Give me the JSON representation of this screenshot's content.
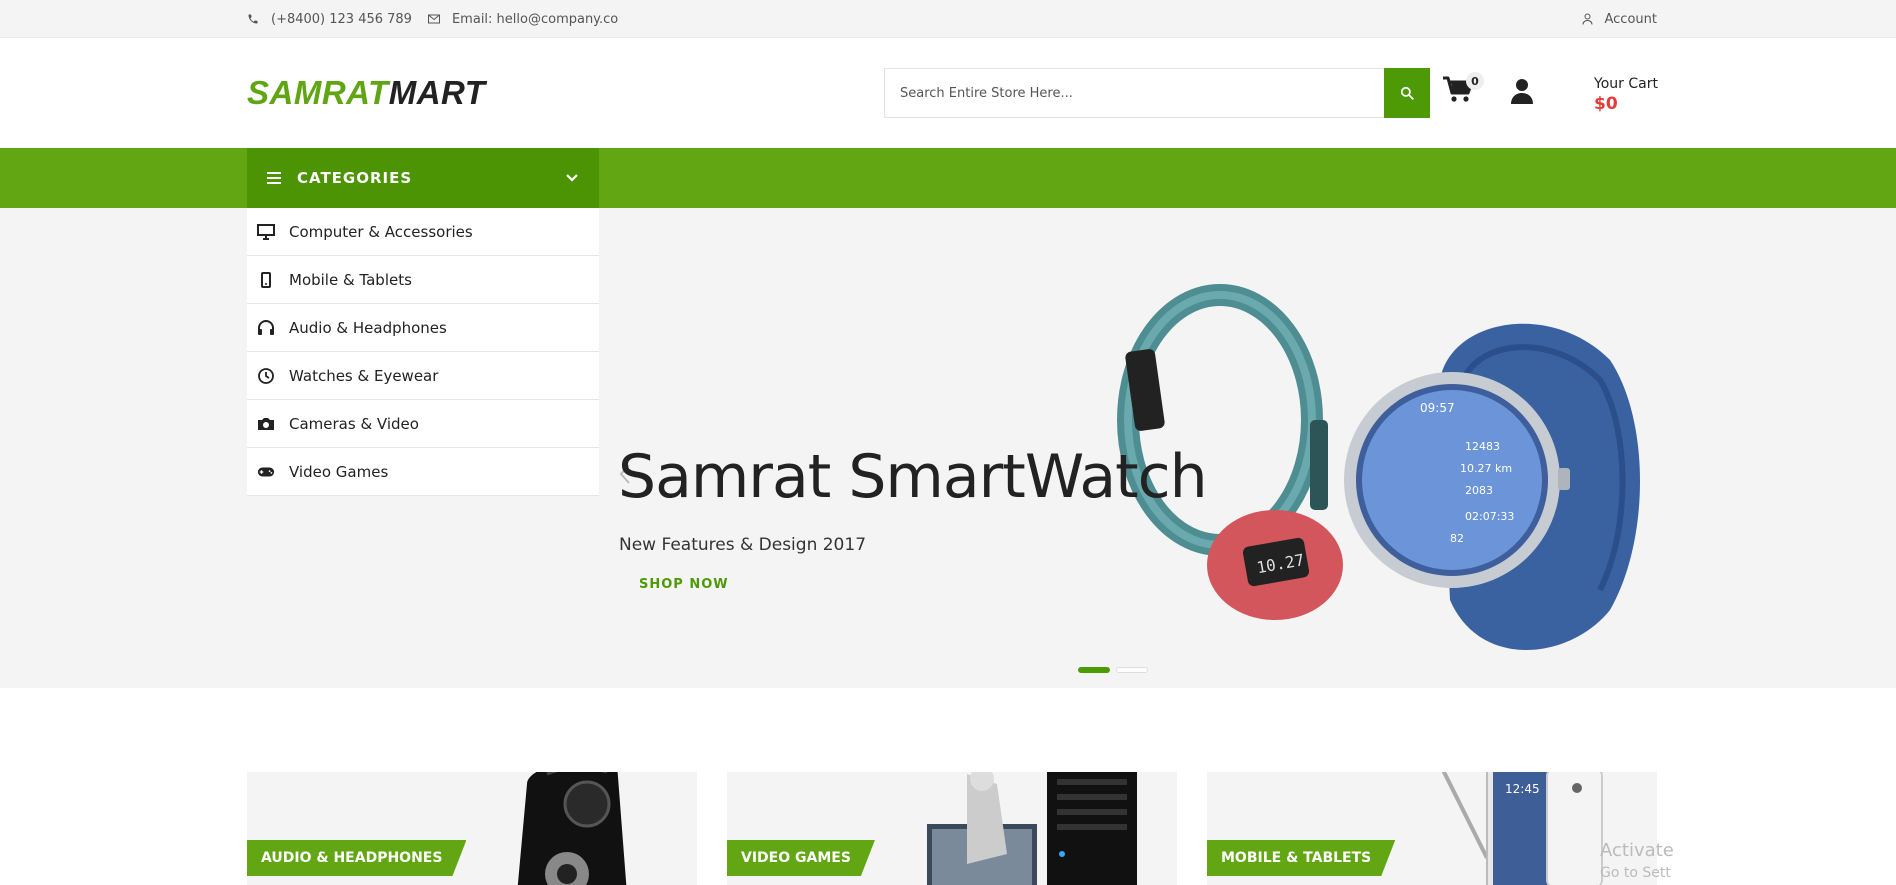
{
  "topbar": {
    "phone": "(+8400) 123 456 789",
    "email": "Email: hello@company.co",
    "account": "Account"
  },
  "header": {
    "logo_part1": "SAMRAT",
    "logo_part2": "MART",
    "search_placeholder": "Search Entire Store Here...",
    "cart_count": "0",
    "cart_label": "Your Cart",
    "cart_amount": "$0"
  },
  "nav": {
    "categories_label": "CATEGORIES"
  },
  "categories": [
    {
      "label": "Computer & Accessories",
      "icon": "monitor-icon"
    },
    {
      "label": "Mobile & Tablets",
      "icon": "mobile-icon"
    },
    {
      "label": "Audio & Headphones",
      "icon": "headphones-icon"
    },
    {
      "label": "Watches & Eyewear",
      "icon": "clock-icon"
    },
    {
      "label": "Cameras & Video",
      "icon": "camera-icon"
    },
    {
      "label": "Video Games",
      "icon": "gamepad-icon"
    }
  ],
  "hero": {
    "title": "Samrat SmartWatch",
    "subtitle": "New Features & Design 2017",
    "cta": "SHOP NOW",
    "slides_total": 2,
    "active_slide": 1
  },
  "banners": [
    {
      "label": "AUDIO & HEADPHONES"
    },
    {
      "label": "VIDEO GAMES"
    },
    {
      "label": "MOBILE & TABLETS"
    }
  ],
  "watermark": {
    "line1": "Activate",
    "line2": "Go to Sett"
  },
  "colors": {
    "brand_green": "#62a713",
    "dark_green": "#4d9404",
    "price_red": "#e63939"
  }
}
